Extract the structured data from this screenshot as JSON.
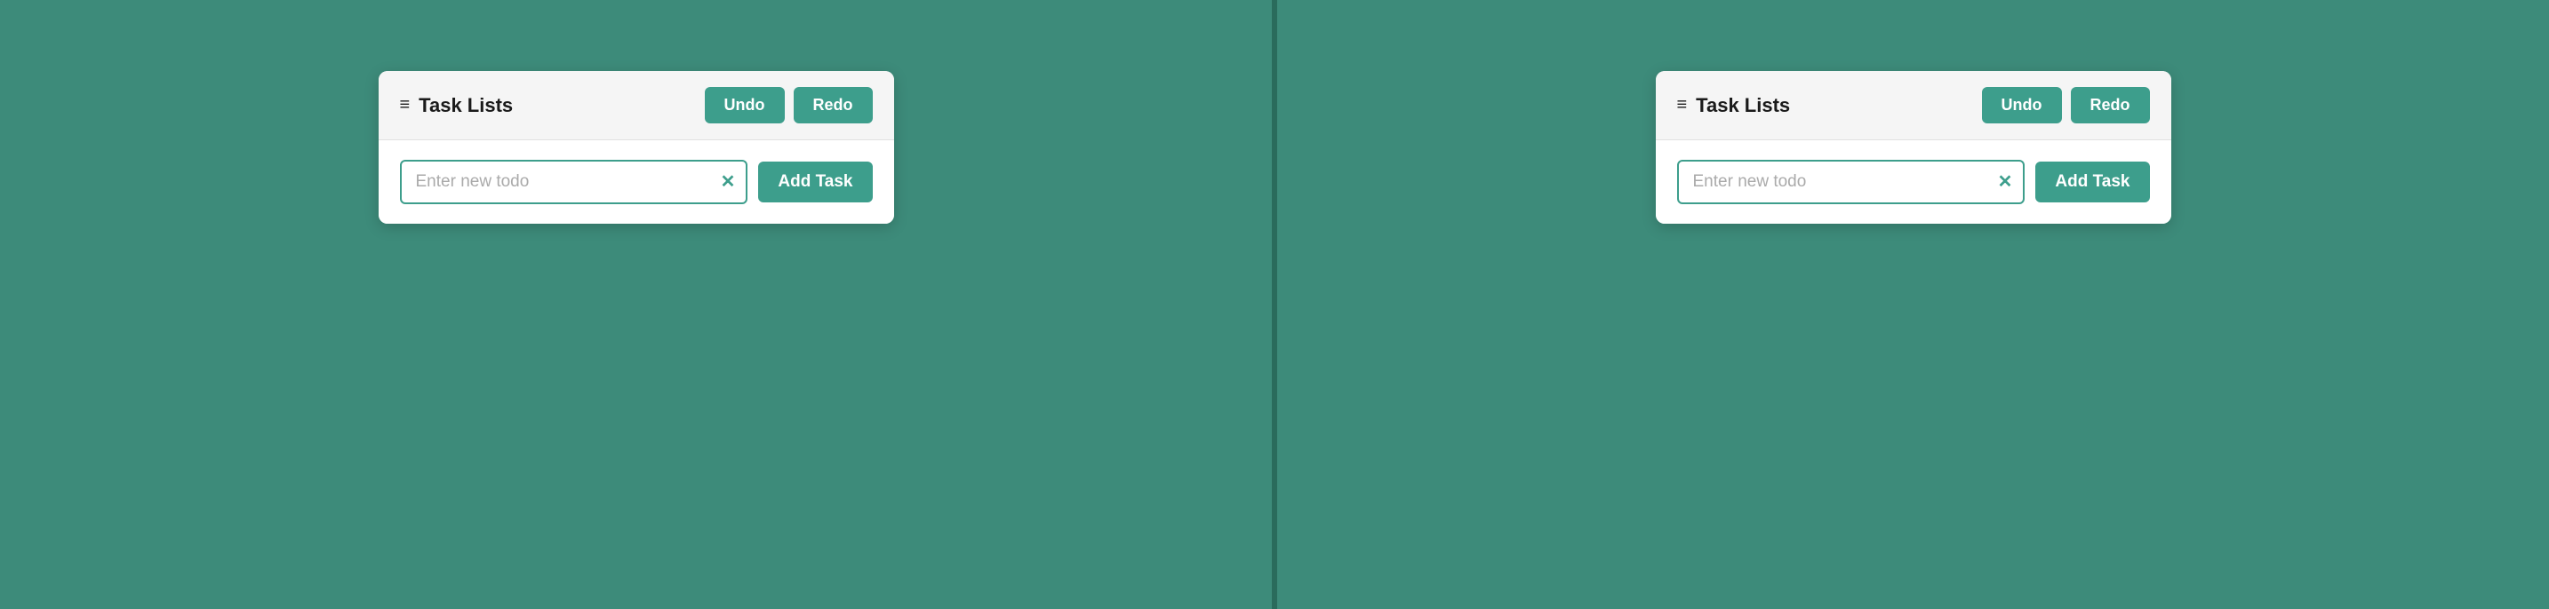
{
  "left_panel": {
    "card": {
      "title": "Task Lists",
      "undo_label": "Undo",
      "redo_label": "Redo",
      "input_placeholder": "Enter new todo",
      "add_task_label": "Add Task",
      "clear_icon": "✕"
    }
  },
  "right_panel": {
    "card": {
      "title": "Task Lists",
      "undo_label": "Undo",
      "redo_label": "Redo",
      "input_placeholder": "Enter new todo",
      "add_task_label": "Add Task",
      "clear_icon": "✕"
    }
  },
  "icons": {
    "task_list": "≡"
  }
}
